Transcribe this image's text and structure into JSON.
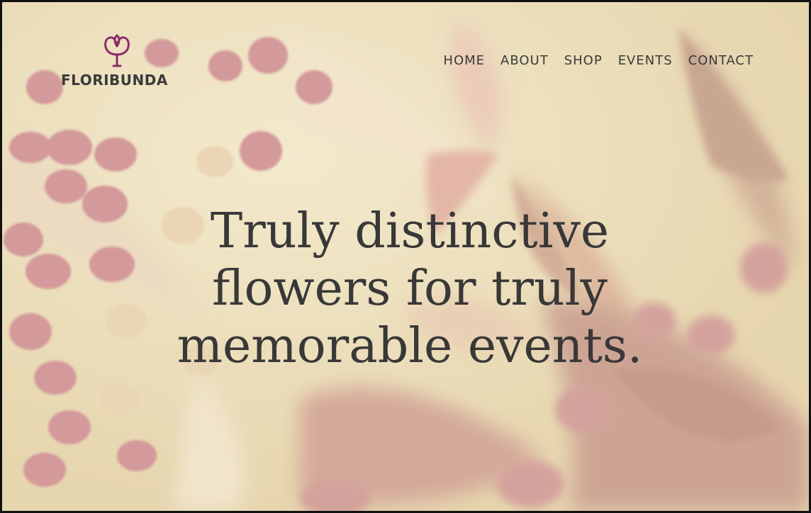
{
  "brand": {
    "name": "FLORIBUNDA",
    "logo_icon": "flower-bud-logo-icon",
    "accent_color": "#8c2d6a"
  },
  "nav": {
    "items": [
      {
        "label": "HOME"
      },
      {
        "label": "ABOUT"
      },
      {
        "label": "SHOP"
      },
      {
        "label": "EVENTS"
      },
      {
        "label": "CONTACT"
      }
    ]
  },
  "hero": {
    "headline": "Truly distinctive flowers for truly memorable events.",
    "background": "blurred pink and cream flower close-up photo"
  },
  "colors": {
    "text": "#3a3a3a",
    "background_cream": "#e9dcb8",
    "petal_pink": "#c98a8e"
  }
}
